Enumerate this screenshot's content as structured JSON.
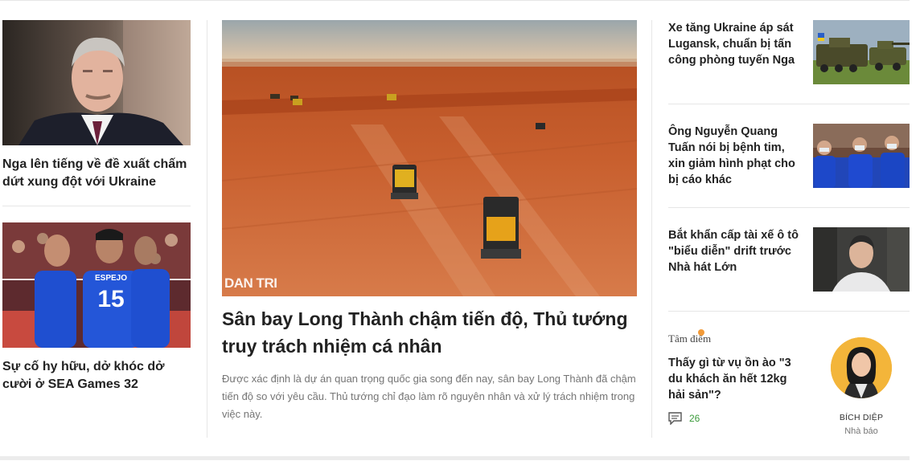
{
  "left_articles": [
    {
      "title": "Nga lên tiếng về đề xuất chấm dứt xung đột với Ukraine",
      "image": "portrait-official"
    },
    {
      "title": "Sự cố hy hữu, dở khóc dở cười ở SEA Games 32",
      "image": "volleyball-players"
    }
  ],
  "jersey": {
    "name": "ESPEJO",
    "number": "15"
  },
  "main_article": {
    "title": "Sân bay Long Thành chậm tiến độ, Thủ tướng truy trách nhiệm cá nhân",
    "description": "Được xác định là dự án quan trọng quốc gia song đến nay, sân bay Long Thành đã chậm tiến độ so với yêu cầu. Thủ tướng chỉ đạo làm rõ nguyên nhân và xử lý trách nhiệm trong việc này.",
    "watermark": "DAN TRI",
    "image": "construction-site-aerial"
  },
  "right_articles": [
    {
      "title": "Xe tăng Ukraine áp sát Lugansk, chuẩn bị tấn công phòng tuyến Nga",
      "image": "military-tank"
    },
    {
      "title": "Ông Nguyễn Quang Tuấn nói bị bệnh tim, xin giảm hình phạt cho bị cáo khác",
      "image": "courtroom-defendants"
    },
    {
      "title": "Bắt khẩn cấp tài xế ô tô \"biểu diễn\" drift trước Nhà hát Lớn",
      "image": "suspect-photo"
    }
  ],
  "focus": {
    "label": "Tâm điểm",
    "title": "Thấy gì từ vụ ồn ào \"3 du khách ăn hết 12kg hải sản\"?",
    "comment_count": "26",
    "author": "BÍCH DIỆP",
    "author_role": "Nhà báo"
  },
  "colors": {
    "accent_green": "#3a9a3a",
    "focus_dot": "#f29a38",
    "divider": "#e6e6e6"
  }
}
